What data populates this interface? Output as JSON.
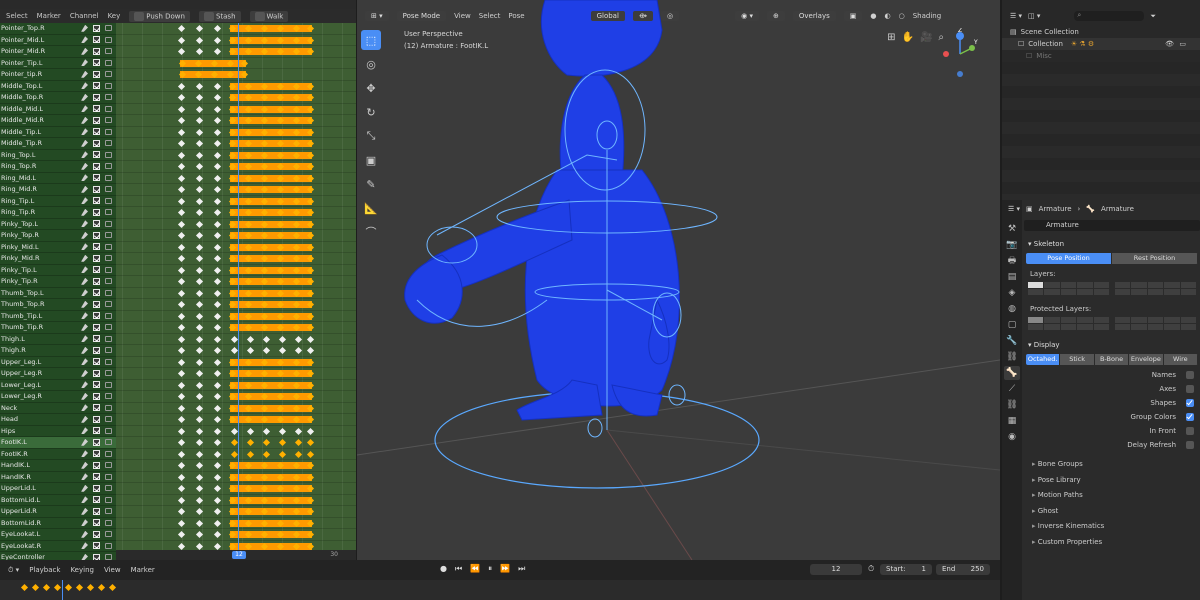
{
  "dopesheet": {
    "menu": [
      "Select",
      "Marker",
      "Channel",
      "Key"
    ],
    "push_down": "Push Down",
    "stash": "Stash",
    "action_name": "Walk",
    "current_frame": "12",
    "end_frame": "30",
    "channels": [
      {
        "name": "Pointer_Top.R",
        "pattern": "full"
      },
      {
        "name": "Pointer_Mid.L",
        "pattern": "full"
      },
      {
        "name": "Pointer_Mid.R",
        "pattern": "full"
      },
      {
        "name": "Pointer_Tip.L",
        "pattern": "short"
      },
      {
        "name": "Pointer_tip.R",
        "pattern": "short"
      },
      {
        "name": "Middle_Top.L",
        "pattern": "full"
      },
      {
        "name": "Middle_Top.R",
        "pattern": "full"
      },
      {
        "name": "Middle_Mid.L",
        "pattern": "full"
      },
      {
        "name": "Middle_Mid.R",
        "pattern": "full"
      },
      {
        "name": "Middle_Tip.L",
        "pattern": "full"
      },
      {
        "name": "Middle_Tip.R",
        "pattern": "full"
      },
      {
        "name": "Ring_Top.L",
        "pattern": "full"
      },
      {
        "name": "Ring_Top.R",
        "pattern": "full"
      },
      {
        "name": "Ring_Mid.L",
        "pattern": "full"
      },
      {
        "name": "Ring_Mid.R",
        "pattern": "full"
      },
      {
        "name": "Ring_Tip.L",
        "pattern": "full"
      },
      {
        "name": "Ring_Tip.R",
        "pattern": "full"
      },
      {
        "name": "Pinky_Top.L",
        "pattern": "full"
      },
      {
        "name": "Pinky_Top.R",
        "pattern": "full"
      },
      {
        "name": "Pinky_Mid.L",
        "pattern": "full"
      },
      {
        "name": "Pinky_Mid.R",
        "pattern": "full"
      },
      {
        "name": "Pinky_Tip.L",
        "pattern": "full"
      },
      {
        "name": "Pinky_Tip.R",
        "pattern": "full"
      },
      {
        "name": "Thumb_Top.L",
        "pattern": "full"
      },
      {
        "name": "Thumb_Top.R",
        "pattern": "full"
      },
      {
        "name": "Thumb_Tip.L",
        "pattern": "full"
      },
      {
        "name": "Thumb_Tip.R",
        "pattern": "full"
      },
      {
        "name": "Thigh.L",
        "pattern": "dots"
      },
      {
        "name": "Thigh.R",
        "pattern": "dots"
      },
      {
        "name": "Upper_Leg.L",
        "pattern": "full"
      },
      {
        "name": "Upper_Leg.R",
        "pattern": "full"
      },
      {
        "name": "Lower_Leg.L",
        "pattern": "full"
      },
      {
        "name": "Lower_Leg.R",
        "pattern": "full"
      },
      {
        "name": "Neck",
        "pattern": "full"
      },
      {
        "name": "Head",
        "pattern": "full"
      },
      {
        "name": "Hips",
        "pattern": "dots"
      },
      {
        "name": "FootIK.L",
        "pattern": "orange-dots",
        "active": true
      },
      {
        "name": "FootIK.R",
        "pattern": "orange-dots"
      },
      {
        "name": "HandIK.L",
        "pattern": "full"
      },
      {
        "name": "HandIK.R",
        "pattern": "full"
      },
      {
        "name": "UpperLid.L",
        "pattern": "full"
      },
      {
        "name": "BottomLid.L",
        "pattern": "full"
      },
      {
        "name": "UpperLid.R",
        "pattern": "full"
      },
      {
        "name": "BottomLid.R",
        "pattern": "full"
      },
      {
        "name": "EyeLookat.L",
        "pattern": "full"
      },
      {
        "name": "EyeLookat.R",
        "pattern": "full"
      },
      {
        "name": "EyeController",
        "pattern": "full"
      }
    ]
  },
  "viewport": {
    "mode": "Pose Mode",
    "menu": [
      "View",
      "Select",
      "Pose"
    ],
    "transform_orientation": "Global",
    "overlays": "Overlays",
    "shading": "Shading",
    "info_line1": "User Perspective",
    "info_line2": "(12) Armature : FootIK.L",
    "gizmo": {
      "z": "Z",
      "y": "Y"
    }
  },
  "outliner": {
    "scene_collection": "Scene Collection",
    "collection": "Collection",
    "misc": "Misc"
  },
  "properties": {
    "header_object": "Armature",
    "header_data": "Armature",
    "name_field": "Armature",
    "skeleton": "Skeleton",
    "pose_position": "Pose Position",
    "rest_position": "Rest Position",
    "layers": "Layers:",
    "protected_layers": "Protected Layers:",
    "display": "Display",
    "display_modes": [
      "Octahed.",
      "Stick",
      "B-Bone",
      "Envelope",
      "Wire"
    ],
    "checks": [
      {
        "label": "Names",
        "on": false
      },
      {
        "label": "Axes",
        "on": false
      },
      {
        "label": "Shapes",
        "on": true
      },
      {
        "label": "Group Colors",
        "on": true
      },
      {
        "label": "In Front",
        "on": false
      },
      {
        "label": "Delay Refresh",
        "on": false
      }
    ],
    "collapsed": [
      "Bone Groups",
      "Pose Library",
      "Motion Paths",
      "Ghost",
      "Inverse Kinematics",
      "Custom Properties"
    ]
  },
  "timeline": {
    "menu": [
      "Playback",
      "Keying",
      "View",
      "Marker"
    ],
    "current_frame": "12",
    "start_label": "Start:",
    "start": "1",
    "end_label": "End",
    "end": "250"
  },
  "colors": {
    "accent": "#4a8ef5",
    "keyframe_selected": "#ff9a00",
    "rig_blue": "#1f3fe6"
  }
}
